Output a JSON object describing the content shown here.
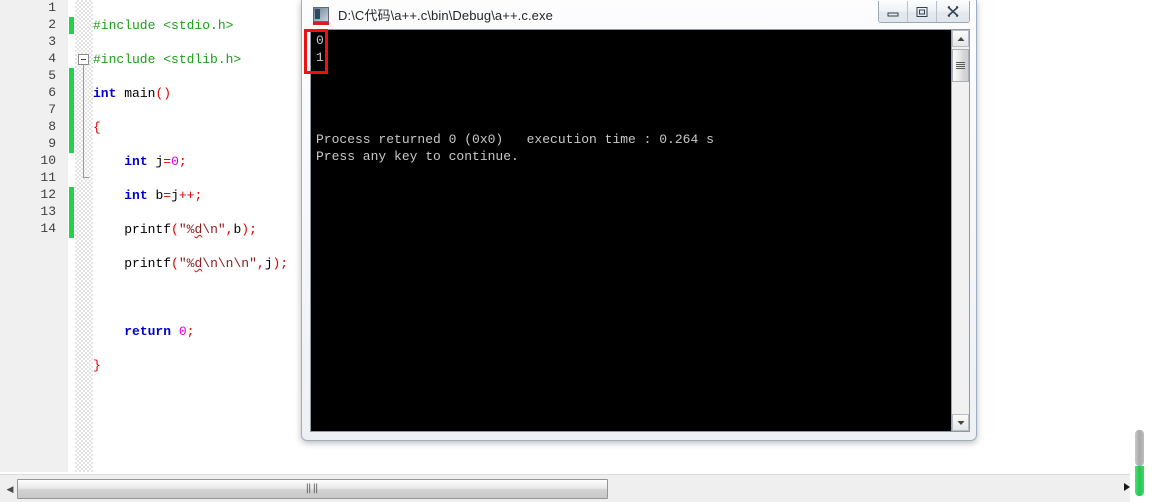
{
  "editor": {
    "name": "code-editor",
    "lines": [
      {
        "no": "1",
        "changed": false,
        "indent": 0
      },
      {
        "no": "2",
        "changed": true,
        "indent": 0
      },
      {
        "no": "3",
        "changed": false,
        "indent": 0
      },
      {
        "no": "4",
        "changed": false,
        "indent": 0
      },
      {
        "no": "5",
        "changed": true,
        "indent": 0
      },
      {
        "no": "6",
        "changed": true,
        "indent": 0
      },
      {
        "no": "7",
        "changed": true,
        "indent": 0
      },
      {
        "no": "8",
        "changed": true,
        "indent": 0
      },
      {
        "no": "9",
        "changed": true,
        "indent": 0
      },
      {
        "no": "10",
        "changed": false,
        "indent": 0
      },
      {
        "no": "11",
        "changed": false,
        "indent": 0
      },
      {
        "no": "12",
        "changed": true,
        "indent": 0
      },
      {
        "no": "13",
        "changed": true,
        "indent": 0
      },
      {
        "no": "14",
        "changed": true,
        "indent": 0
      }
    ],
    "code_lines": [
      "#include <stdio.h>",
      "#include <stdlib.h>",
      "int main()",
      "{",
      "    int j=0;",
      "    int b=j++;",
      "    printf(\"%d\\n\",b);",
      "    printf(\"%d\\n\\n\\n\",j);",
      "",
      "    return 0;",
      "}",
      "",
      "",
      ""
    ],
    "colors": {
      "preprocessor": "#1a9f1a",
      "keyword": "#0000d0",
      "identifier": "#000000",
      "punctuation": "#dd0000",
      "number": "#e000e0",
      "string": "#8b1a1a",
      "linenumber": "#3f3f3f",
      "change_marker": "#23d24c",
      "gutter_bg": "#f0f0f0"
    },
    "hscrollbar": {
      "left_arrow": "◀",
      "grip": "‖‖"
    },
    "vscrollbar": {
      "thumb_gray": "#a8a8a8",
      "thumb_green": "#22c94e"
    }
  },
  "console": {
    "title": "D:\\C代码\\a++.c\\bin\\Debug\\a++.c.exe",
    "icon": "console-app-icon",
    "window_buttons": [
      {
        "name": "minimize-button",
        "glyph": "minimize"
      },
      {
        "name": "restore-button",
        "glyph": "restore"
      },
      {
        "name": "close-button",
        "glyph": "close"
      }
    ],
    "output_lines": [
      "0",
      "1",
      "",
      "",
      "",
      "",
      "Process returned 0 (0x0)   execution time : 0.264 s",
      "Press any key to continue."
    ],
    "output_text": "0\n1\n\n\n\n\nProcess returned 0 (0x0)   execution time : 0.264 s\nPress any key to continue.",
    "background": "#000000",
    "foreground": "#c8c8c8",
    "scrollbar": {
      "up_arrow": "▲",
      "down_arrow": "▼"
    }
  },
  "annotation": {
    "name": "red-highlight-box",
    "color": "#ee1111",
    "targets": "0 and 1 output values"
  }
}
